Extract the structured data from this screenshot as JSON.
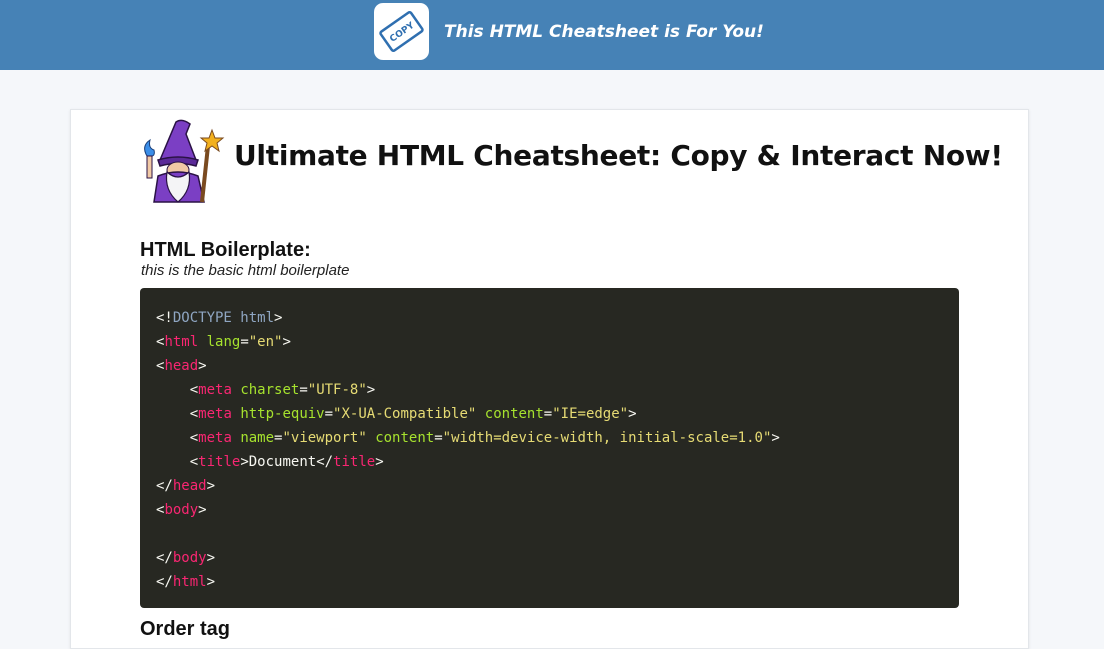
{
  "header": {
    "logo_icon": "copy-stamp-icon",
    "logo_text": "COPY",
    "title": "This HTML Cheatsheet is For You!"
  },
  "main": {
    "mascot_icon": "wizard-icon",
    "title": "Ultimate HTML Cheatsheet: Copy & Interact Now!",
    "sections": [
      {
        "heading": "HTML Boilerplate:",
        "description": "this is the basic html boilerplate",
        "code_lines": [
          [
            "<!",
            "DOCTYPE html",
            ">"
          ],
          [
            "<",
            "html",
            " ",
            "lang",
            "=",
            "\"en\"",
            ">"
          ],
          [
            "<",
            "head",
            ">"
          ],
          [
            "    <",
            "meta",
            " ",
            "charset",
            "=",
            "\"UTF-8\"",
            ">"
          ],
          [
            "    <",
            "meta",
            " ",
            "http-equiv",
            "=",
            "\"X-UA-Compatible\"",
            " ",
            "content",
            "=",
            "\"IE=edge\"",
            ">"
          ],
          [
            "    <",
            "meta",
            " ",
            "name",
            "=",
            "\"viewport\"",
            " ",
            "content",
            "=",
            "\"width=device-width, initial-scale=1.0\"",
            ">"
          ],
          [
            "    <",
            "title",
            ">",
            "Document",
            "</",
            "title",
            ">"
          ],
          [
            "</",
            "head",
            ">"
          ],
          [
            "<",
            "body",
            ">"
          ],
          [
            ""
          ],
          [
            "</",
            "body",
            ">"
          ],
          [
            "</",
            "html",
            ">"
          ]
        ]
      },
      {
        "heading": "Order tag"
      }
    ]
  },
  "colors": {
    "header_bg": "#4682b6",
    "code_bg": "#272822",
    "tag": "#f92672",
    "attribute": "#a6e22e",
    "string": "#e6db74",
    "doctype": "#8fa6c2"
  }
}
